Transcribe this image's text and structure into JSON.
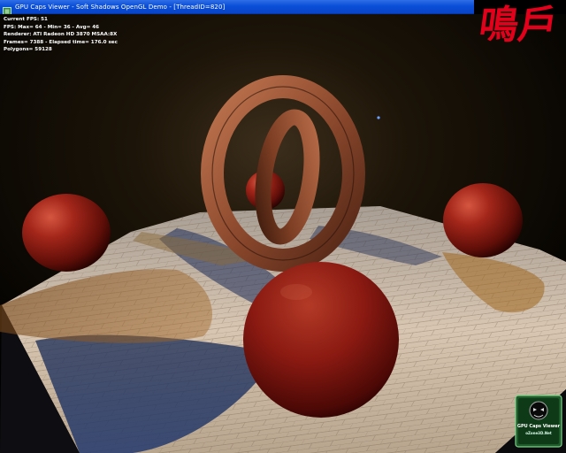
{
  "window": {
    "title": "GPU Caps Viewer - Soft Shadows OpenGL Demo - [ThreadID=820]"
  },
  "hud": {
    "current_fps": "Current FPS: 51",
    "fps_stats": "FPS: Max= 64 - Min= 36 - Avg= 46",
    "renderer": "Renderer: ATI Radeon HD 3870   MSAA:8X",
    "frames": "Frames= 7388 - Elapsed time= 176.0 sec",
    "polygons": "Polygons= 59128"
  },
  "logo": {
    "text": "鳴戶",
    "accent": "#e3001b"
  },
  "badge": {
    "title": "GPU Caps Viewer",
    "subtitle": "oZone3D.Net"
  },
  "scene": {
    "description_icons": [
      "floor-tiles",
      "red-spheres",
      "wooden-torus-rings"
    ],
    "sphere_color": "#8b1a12",
    "floor_color": "#c9b9a6"
  }
}
